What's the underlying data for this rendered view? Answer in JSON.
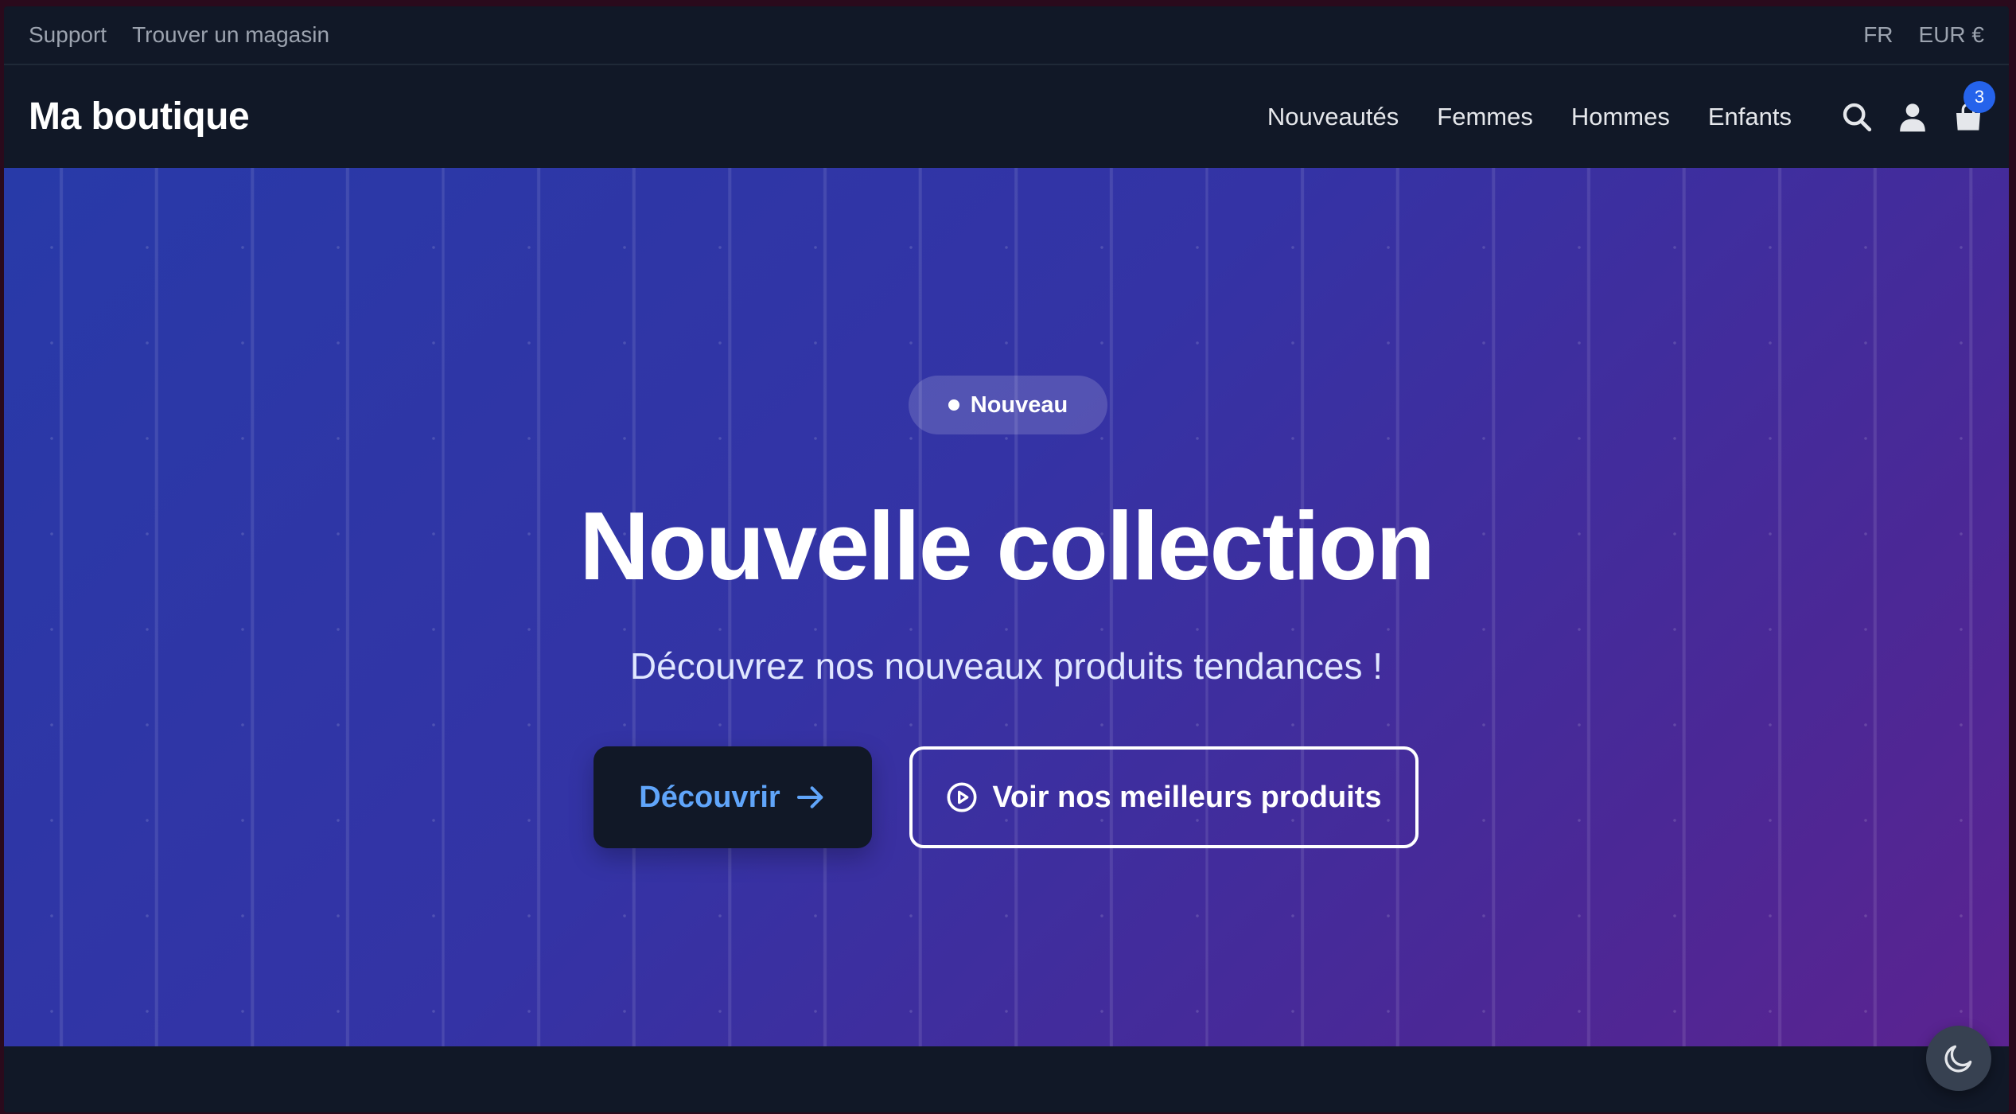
{
  "topbar": {
    "links": [
      "Support",
      "Trouver un magasin"
    ],
    "language": "FR",
    "currency": "EUR €"
  },
  "header": {
    "logo": "Ma boutique",
    "nav": [
      "Nouveautés",
      "Femmes",
      "Hommes",
      "Enfants"
    ],
    "icons": [
      "search-icon",
      "user-icon",
      "shopping-bag-icon"
    ],
    "cart_count": "3"
  },
  "hero": {
    "badge": "Nouveau",
    "title": "Nouvelle collection",
    "subtitle": "Découvrez nos nouveaux produits tendances !",
    "primary_cta": "Découvrir",
    "secondary_cta": "Voir nos meilleurs produits"
  },
  "theme_toggle": {
    "icon": "moon-icon"
  },
  "colors": {
    "accent": "#2563eb",
    "primary_cta_text": "#60a5fa",
    "background": "#111827",
    "hero_gradient_start": "#283aa8",
    "hero_gradient_end": "#5b2390"
  }
}
